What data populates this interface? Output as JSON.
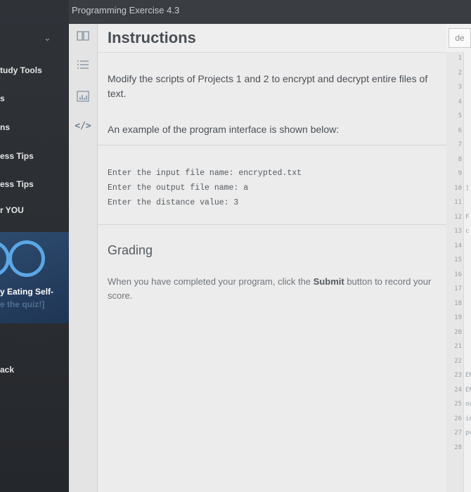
{
  "sidebar": {
    "items": [
      {
        "label": "tudy Tools"
      },
      {
        "label": "s"
      },
      {
        "label": "ns"
      },
      {
        "label": "ess Tips"
      },
      {
        "label": "ess Tips"
      },
      {
        "label": "r YOU"
      },
      {
        "label": "ack"
      }
    ],
    "promo": {
      "title": "y Eating Self-",
      "subtitle": "e the quiz!]"
    }
  },
  "topbar": {
    "title": "Programming Exercise 4.3"
  },
  "instructions": {
    "heading": "Instructions",
    "paragraph1": "Modify the scripts of Projects 1 and 2 to encrypt and decrypt entire files of text.",
    "paragraph2": "An example of the program interface is shown below:",
    "code_lines": [
      "Enter the input file name: encrypted.txt",
      "Enter the output file name: a",
      "Enter the distance value: 3"
    ],
    "grading_heading": "Grading",
    "grading_text_before": "When you have completed your program, click the ",
    "grading_text_bold": "Submit",
    "grading_text_after": " button to record your score."
  },
  "editor": {
    "tab_label": "de",
    "line_numbers": [
      "1",
      "2",
      "3",
      "4",
      "5",
      "6",
      "7",
      "8",
      "9",
      "10",
      "11",
      "12",
      "13",
      "14",
      "15",
      "16",
      "17",
      "18",
      "19",
      "20",
      "21",
      "22",
      "23",
      "24",
      "25",
      "26",
      "27",
      "28"
    ],
    "fragments": [
      {
        "line": "10",
        "text": "]"
      },
      {
        "line": "12",
        "text": "F"
      },
      {
        "line": "13",
        "text": "c"
      },
      {
        "line": "23",
        "text": "EN"
      },
      {
        "line": "24",
        "text": "EN"
      },
      {
        "line": "25",
        "text": "ou"
      },
      {
        "line": "26",
        "text": "in"
      },
      {
        "line": "27",
        "text": "pu"
      }
    ]
  },
  "colors": {
    "sidebar_bg": "#2f3338",
    "panel_bg": "#ececec",
    "accent_ring": "#5aa7e6"
  }
}
